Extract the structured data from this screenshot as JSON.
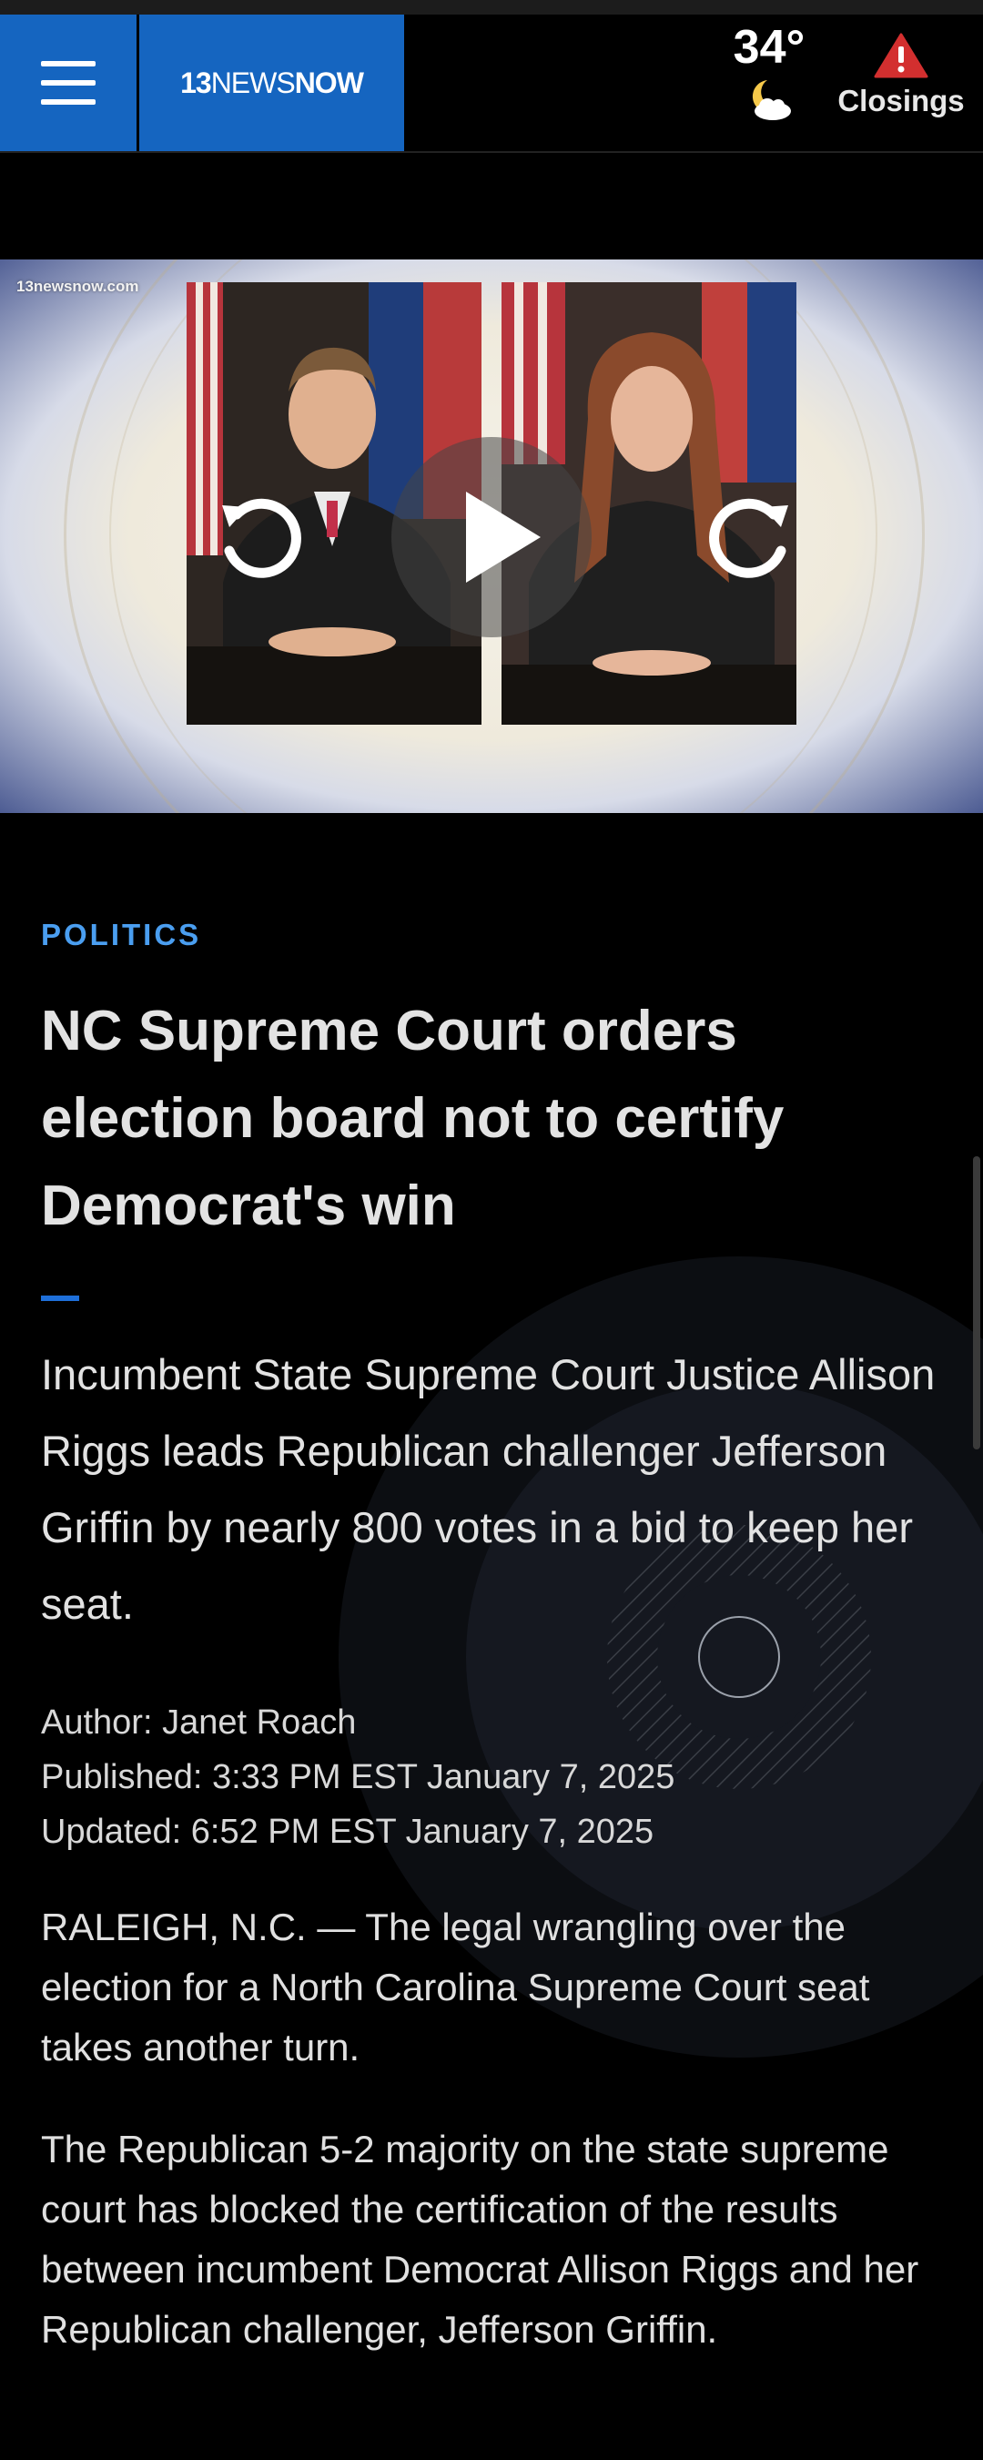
{
  "header": {
    "logo_prefix": "13",
    "logo_mid": "NEWS",
    "logo_suffix": "NOW",
    "temperature": "34°",
    "weather_icon": "moon-cloud-icon",
    "closings_label": "Closings",
    "closings_icon": "alert-triangle-icon"
  },
  "video": {
    "watermark": "13newsnow.com",
    "controls": [
      "rewind-icon",
      "play-icon",
      "forward-icon"
    ]
  },
  "article": {
    "category": "POLITICS",
    "headline": "NC Supreme Court orders election board not to certify Democrat's win",
    "dek": "Incumbent State Supreme Court Justice Allison Riggs leads Republican challenger Jefferson Griffin by nearly 800 votes in a bid to keep her seat.",
    "author": "Author: Janet Roach",
    "published": "Published: 3:33 PM EST January 7, 2025",
    "updated": "Updated: 6:52 PM EST January 7, 2025",
    "paragraphs": [
      "RALEIGH, N.C. — The legal wrangling over the election for a North Carolina Supreme Court seat takes another turn.",
      "The Republican 5-2 majority on the state supreme court has blocked the certification of the results between incumbent Democrat Allison Riggs and her Republican challenger, Jefferson Griffin."
    ]
  },
  "colors": {
    "brand_blue": "#1565c0",
    "category_blue": "#4a9ef0",
    "alert_red": "#d32f2f"
  }
}
